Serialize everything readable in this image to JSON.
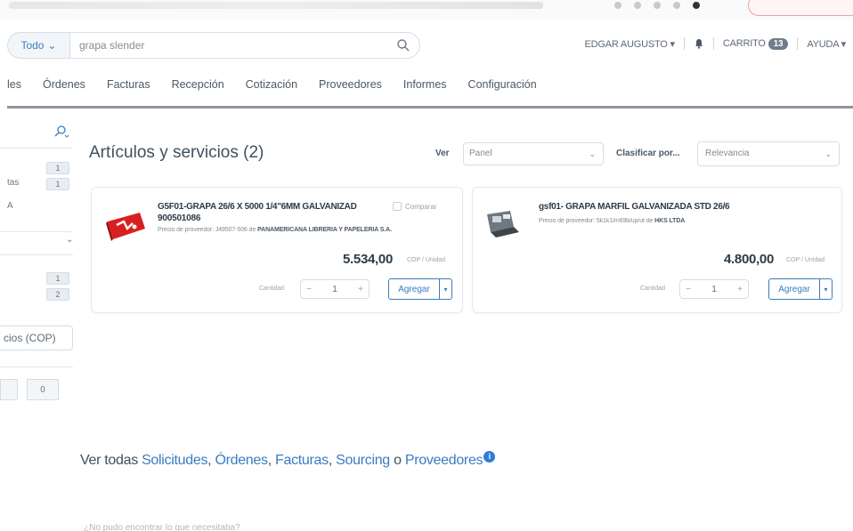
{
  "search": {
    "scope_label": "Todo",
    "value": "grapa slender"
  },
  "user_nav": {
    "user": "EDGAR AUGUSTO",
    "cart_label": "CARRITO",
    "cart_count": "13",
    "help": "AYUDA"
  },
  "menu": {
    "items": [
      "les",
      "Órdenes",
      "Facturas",
      "Recepción",
      "Cotización",
      "Proveedores",
      "Informes",
      "Configuración"
    ]
  },
  "sidebar": {
    "badges": [
      "1",
      "1",
      "1",
      "2"
    ],
    "text_a": "tas",
    "text_b": "A",
    "currency": "cios (COP)",
    "input_a": "",
    "input_b": "0"
  },
  "results": {
    "title": "Artículos y servicios (2)",
    "view_label": "Ver",
    "view_value": "Panel",
    "sort_label": "Clasificar por...",
    "sort_value": "Relevancia"
  },
  "products": [
    {
      "title": "G5F01-GRAPA 26/6 X 5000 1/4\"6MM GALVANIZAD",
      "code": "900501086",
      "supplier_prefix": "Precio de proveedor: J49507-506 de",
      "supplier": "PANAMERICANA LIBRERÍA Y PAPELERÍA S.A.",
      "compare": "Comparar",
      "price": "5.534,00",
      "unit": "COP / Unidad",
      "qty_label": "Cantidad",
      "qty": "1",
      "add": "Agregar"
    },
    {
      "title": "gsf01- GRAPA MARFIL GALVANIZADA STD 26/6",
      "code": "",
      "supplier_prefix": "Precio de proveedor: 5k1k1/m69b/up/ut de",
      "supplier": "HKS LTDA",
      "compare": "",
      "price": "4.800,00",
      "unit": "COP / Unidad",
      "qty_label": "Cantidad",
      "qty": "1",
      "add": "Agregar"
    }
  ],
  "view_all": {
    "prefix": "Ver todas",
    "links": [
      "Solicitudes",
      "Órdenes",
      "Facturas",
      "Sourcing"
    ],
    "conj": "o",
    "last": "Proveedores",
    "info": "i"
  },
  "bottom_text": "¿No pudo encontrar lo que necesitaba?",
  "colors": {
    "accent": "#3a7cc2",
    "menu_line": "#8e969e",
    "info": "#2d7fd6"
  }
}
